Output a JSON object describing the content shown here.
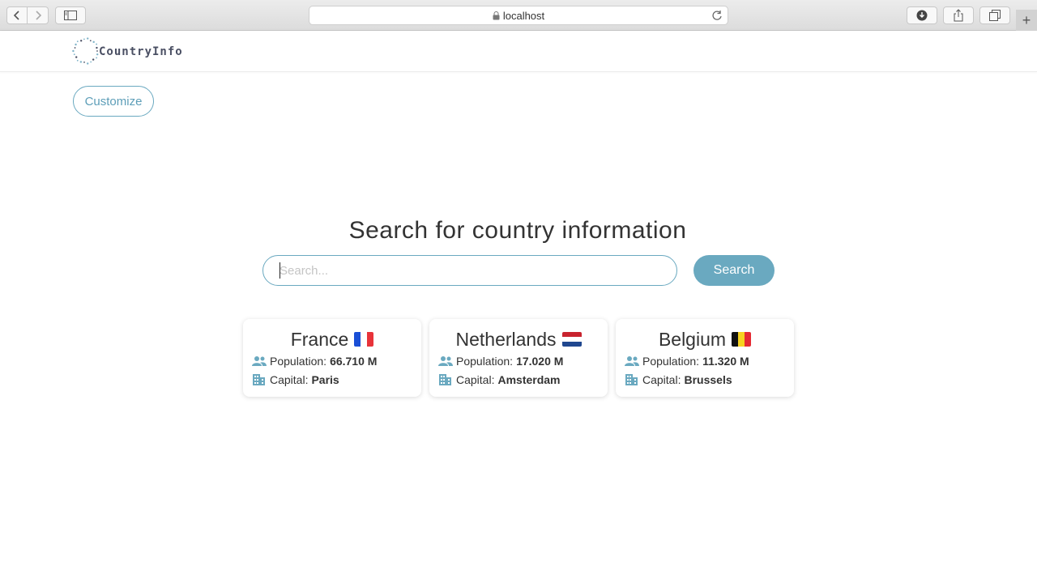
{
  "browser": {
    "url": "localhost",
    "new_tab_symbol": "+"
  },
  "app": {
    "logo_text": "CountryInfo",
    "customize_label": "Customize",
    "heading": "Search for country information",
    "search_placeholder": "Search...",
    "search_button_label": "Search"
  },
  "cards": [
    {
      "name": "France",
      "population_label": "Population:",
      "population": "66.710 M",
      "capital_label": "Capital:",
      "capital": "Paris",
      "flag": "france-flag-icon"
    },
    {
      "name": "Netherlands",
      "population_label": "Population:",
      "population": "17.020 M",
      "capital_label": "Capital:",
      "capital": "Amsterdam",
      "flag": "netherlands-flag-icon"
    },
    {
      "name": "Belgium",
      "population_label": "Population:",
      "population": "11.320 M",
      "capital_label": "Capital:",
      "capital": "Brussels",
      "flag": "belgium-flag-icon"
    }
  ],
  "colors": {
    "accent": "#6aa9c0",
    "logo_text": "#4a4f63"
  }
}
